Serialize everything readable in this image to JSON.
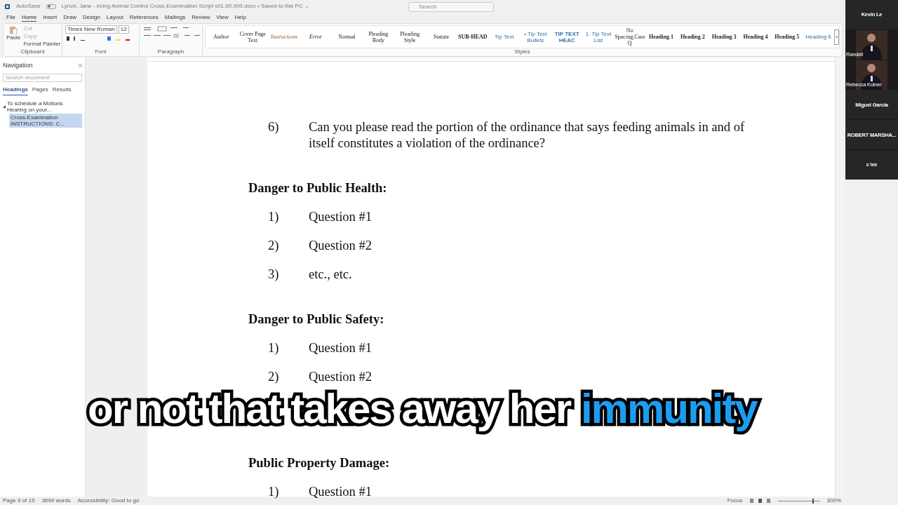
{
  "title_bar": {
    "autosave": "AutoSave",
    "autosave_on": false,
    "title": "Lynch, Jane - Irving Animal Control Cross-Examination Script v01.00.000.docx • Saved to this PC ⌄",
    "search_placeholder": "Search"
  },
  "menu_tabs": [
    {
      "label": "File",
      "selected": false
    },
    {
      "label": "Home",
      "selected": true
    },
    {
      "label": "Insert",
      "selected": false
    },
    {
      "label": "Draw",
      "selected": false
    },
    {
      "label": "Design",
      "selected": false
    },
    {
      "label": "Layout",
      "selected": false
    },
    {
      "label": "References",
      "selected": false
    },
    {
      "label": "Mailings",
      "selected": false
    },
    {
      "label": "Review",
      "selected": false
    },
    {
      "label": "View",
      "selected": false
    },
    {
      "label": "Help",
      "selected": false
    }
  ],
  "ribbon": {
    "clipboard": {
      "paste": "Paste",
      "cut": "Cut",
      "copy": "Copy",
      "format_painter": "Format Painter",
      "label": "Clipboard"
    },
    "font": {
      "name": "Times New Roman",
      "size": "12",
      "label": "Font"
    },
    "paragraph": {
      "label": "Paragraph"
    },
    "styles": {
      "label": "Styles",
      "items": [
        {
          "name": "Author",
          "kind": "italic"
        },
        {
          "name": "Cover Page Text",
          "kind": "plain"
        },
        {
          "name": "Instructions",
          "kind": "accent"
        },
        {
          "name": "Error",
          "kind": "italic"
        },
        {
          "name": "Normal",
          "kind": "plain"
        },
        {
          "name": "Pleading Body",
          "kind": "plain"
        },
        {
          "name": "Pleading Style",
          "kind": "plain"
        },
        {
          "name": "Statute",
          "kind": "plain"
        },
        {
          "name": "SUB-HEAD",
          "kind": "bold"
        },
        {
          "name": "Tip Text",
          "kind": "tip"
        },
        {
          "name": "• Tip Text Bullets",
          "kind": "tip"
        },
        {
          "name": "TIP TEXT HEAC",
          "kind": "tipbold"
        },
        {
          "name": "1. Tip Text List",
          "kind": "tip"
        },
        {
          "name": "No Spacing,Case Q",
          "kind": "plain"
        },
        {
          "name": "Heading 1",
          "kind": "bold"
        },
        {
          "name": "Heading 2",
          "kind": "bold"
        },
        {
          "name": "Heading 3",
          "kind": "bold"
        },
        {
          "name": "Heading 4",
          "kind": "bold"
        },
        {
          "name": "Heading 5",
          "kind": "bold"
        },
        {
          "name": "Heading 6",
          "kind": "tip"
        }
      ]
    }
  },
  "navigation": {
    "title": "Navigation",
    "search_placeholder": "Search document",
    "tabs": [
      {
        "label": "Headings",
        "selected": true
      },
      {
        "label": "Pages",
        "selected": false
      },
      {
        "label": "Results",
        "selected": false
      }
    ],
    "tree": [
      {
        "label": "To schedule a Motions Hearing on your...",
        "expanded": true,
        "selected": false,
        "children": [
          {
            "label": "Cross-Examination INSTRUCTIONS: C...",
            "selected": true
          }
        ]
      }
    ]
  },
  "document": [
    {
      "kind": "item",
      "number": "6)",
      "text": "Can you please read the portion of the ordinance that says feeding animals in and of itself constitutes a violation of the ordinance?"
    },
    {
      "kind": "heading",
      "text": "Danger to Public Health:"
    },
    {
      "kind": "item",
      "number": "1)",
      "text": "Question #1"
    },
    {
      "kind": "item",
      "number": "2)",
      "text": "Question #2"
    },
    {
      "kind": "item",
      "number": "3)",
      "text": "etc., etc."
    },
    {
      "kind": "heading",
      "text": "Danger to Public Safety:"
    },
    {
      "kind": "item",
      "number": "1)",
      "text": "Question #1"
    },
    {
      "kind": "item",
      "number": "2)",
      "text": "Question #2"
    },
    {
      "kind": "caption",
      "parts": [
        {
          "text": "or not that takes away her",
          "highlight": false
        },
        {
          "text": "immunity",
          "highlight": true
        }
      ]
    },
    {
      "kind": "heading",
      "text": "Public Property Damage:"
    },
    {
      "kind": "item",
      "number": "1)",
      "text": "Question #1"
    }
  ],
  "participants": [
    {
      "name": "Kevin Le",
      "kind": "name"
    },
    {
      "name": "Randell",
      "kind": "video"
    },
    {
      "name": "Rebecca Koiner",
      "kind": "video"
    },
    {
      "name": "Miguel Garcia",
      "kind": "name"
    },
    {
      "name": "ROBERT  MARSHA...",
      "kind": "name"
    },
    {
      "name": "c lee",
      "kind": "name"
    }
  ],
  "status_bar": {
    "page": "Page 9 of 15",
    "words": "3699 words",
    "accessibility": "Accessibility: Good to go",
    "focus": "Focus",
    "zoom": "300%",
    "level": 0.82
  }
}
